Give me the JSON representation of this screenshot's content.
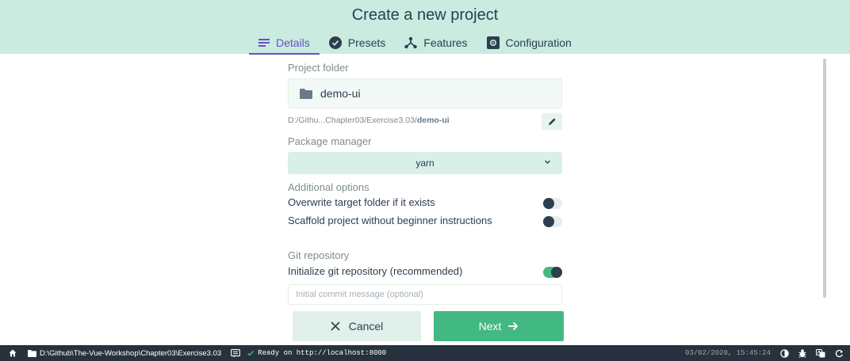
{
  "header": {
    "title": "Create a new project",
    "tabs": [
      {
        "label": "Details",
        "icon": "list-icon",
        "active": true
      },
      {
        "label": "Presets",
        "icon": "check-circle-icon",
        "active": false
      },
      {
        "label": "Features",
        "icon": "graph-icon",
        "active": false
      },
      {
        "label": "Configuration",
        "icon": "settings-box-icon",
        "active": false
      }
    ]
  },
  "form": {
    "project_folder_label": "Project folder",
    "project_folder_value": "demo-ui",
    "path_prefix": "D:/Githu...Chapter03/Exercise3.03/",
    "path_bold": "demo-ui",
    "package_manager_label": "Package manager",
    "package_manager_value": "yarn",
    "additional_options_label": "Additional options",
    "options": [
      {
        "label": "Overwrite target folder if it exists",
        "on": false
      },
      {
        "label": "Scaffold project without beginner instructions",
        "on": false
      }
    ],
    "git_label": "Git repository",
    "git_init_label": "Initialize git repository (recommended)",
    "git_init_on": true,
    "commit_placeholder": "Initial commit message (optional)"
  },
  "buttons": {
    "cancel_label": "Cancel",
    "next_label": "Next"
  },
  "statusbar": {
    "path": "D:\\Github\\The-Vue-Workshop\\Chapter03\\Exercise3.03",
    "ready_message": "Ready on http://localhost:8000",
    "datetime": "03/02/2020, 15:45:24"
  },
  "colors": {
    "header_bg": "#c9ebe0",
    "accent_purple": "#6a4fc4",
    "green": "#42b983",
    "dark": "#2c3e50",
    "statusbar_bg": "#26323d"
  }
}
